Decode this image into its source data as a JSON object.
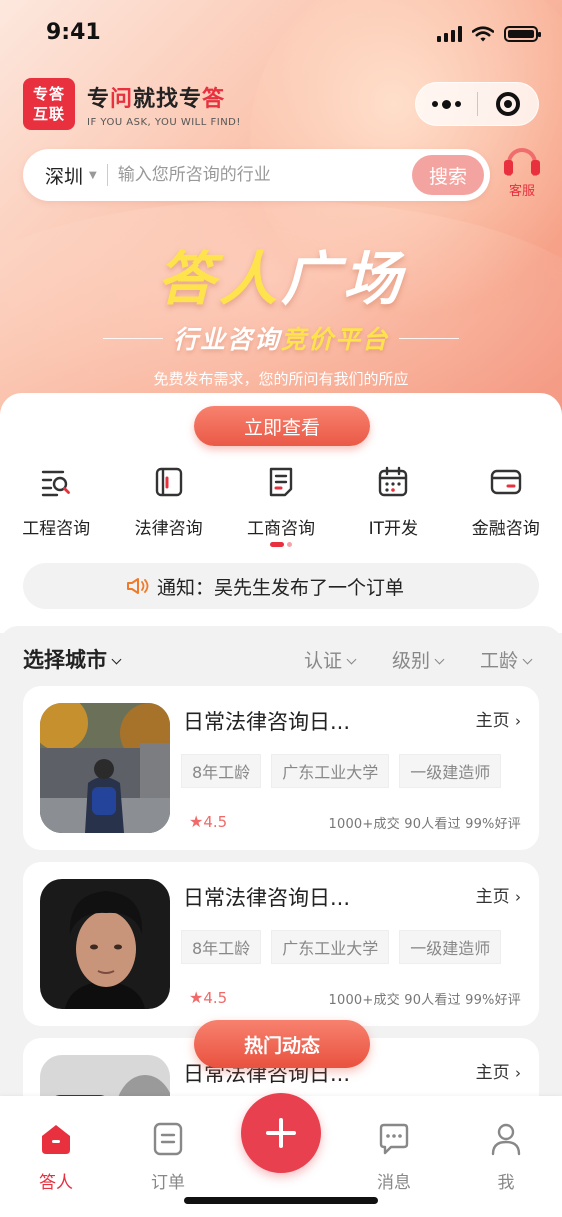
{
  "status_bar": {
    "time": "9:41"
  },
  "brand": {
    "logo_text": "专答\n互联",
    "slogan_parts": [
      "专",
      "问",
      "就找专",
      "答"
    ],
    "slogan_en": "IF YOU ASK, YOU WILL FIND!"
  },
  "search": {
    "city": "深圳",
    "placeholder": "输入您所咨询的行业",
    "button_label": "搜索",
    "service_label": "客服"
  },
  "banner": {
    "title_yellow": "答人",
    "title_white": "广场",
    "subtitle_white": "行业咨询",
    "subtitle_yellow": "竞价平台",
    "description": "免费发布需求，您的所问有我们的所应",
    "view_button": "立即查看"
  },
  "categories": [
    {
      "label": "工程咨询",
      "icon": "document-search-icon"
    },
    {
      "label": "法律咨询",
      "icon": "book-icon"
    },
    {
      "label": "工商咨询",
      "icon": "form-icon"
    },
    {
      "label": "IT开发",
      "icon": "calendar-icon"
    },
    {
      "label": "金融咨询",
      "icon": "card-icon"
    }
  ],
  "notice": {
    "text": "通知：吴先生发布了一个订单",
    "icon": "speaker-icon"
  },
  "filters": {
    "city_label": "选择城市",
    "options": [
      "认证",
      "级别",
      "工龄"
    ]
  },
  "experts": [
    {
      "name": "日常法律咨询日...",
      "home_link": "主页",
      "tags": [
        "8年工龄",
        "广东工业大学",
        "一级建造师"
      ],
      "rating": "4.5",
      "stats": "1000+成交  90人看过  99%好评"
    },
    {
      "name": "日常法律咨询日...",
      "home_link": "主页",
      "tags": [
        "8年工龄",
        "广东工业大学",
        "一级建造师"
      ],
      "rating": "4.5",
      "stats": "1000+成交  90人看过  99%好评"
    },
    {
      "name": "日常法律咨询日...",
      "home_link": "主页"
    }
  ],
  "hot_button": "热门动态",
  "tabbar": {
    "items": [
      {
        "label": "答人",
        "icon": "home-icon",
        "active": true
      },
      {
        "label": "订单",
        "icon": "order-icon",
        "active": false
      },
      {
        "label": "消息",
        "icon": "message-icon",
        "active": false
      },
      {
        "label": "我",
        "icon": "user-icon",
        "active": false
      }
    ],
    "fab_icon": "plus-icon"
  },
  "colors": {
    "accent": "#e8303f",
    "star": "#f06a6a",
    "banner_yellow": "#ffe34d"
  }
}
